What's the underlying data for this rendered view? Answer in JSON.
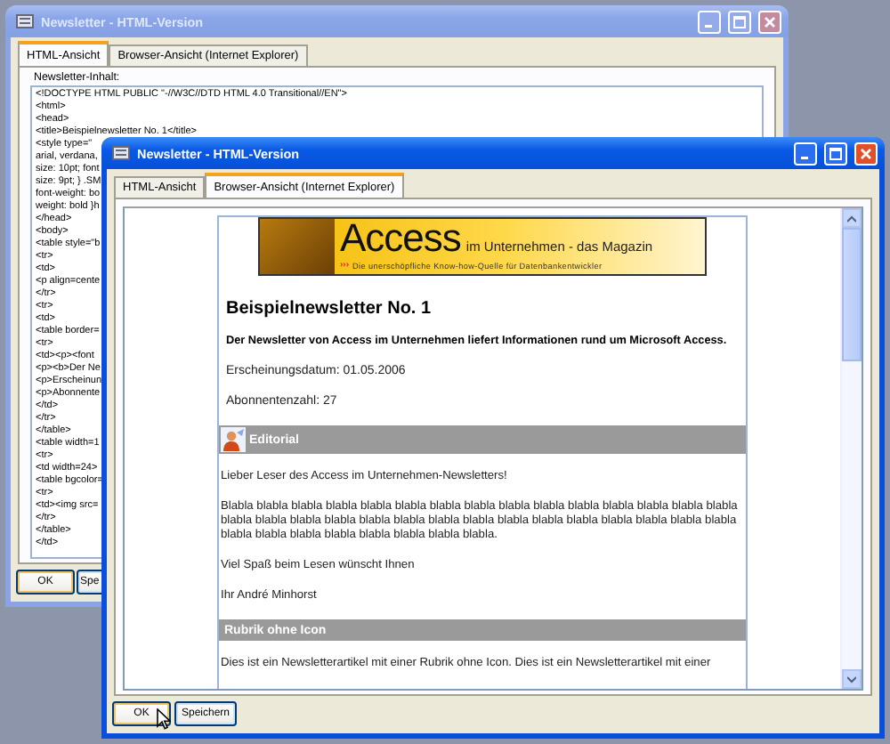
{
  "windows": [
    {
      "kind": "source",
      "title": "Newsletter - HTML-Version",
      "active": false,
      "tabs": [
        {
          "label": "HTML-Ansicht",
          "selected": true
        },
        {
          "label": "Browser-Ansicht (Internet Explorer)",
          "selected": false
        }
      ],
      "field_label": "Newsletter-Inhalt:",
      "code_lines": [
        "<!DOCTYPE HTML PUBLIC \"-//W3C//DTD HTML 4.0 Transitional//EN\">",
        "<html>",
        "<head>",
        "<title>Beispielnewsletter No. 1</title>",
        "<style type=\"",
        "arial, verdana,",
        "size: 10pt; font",
        "size: 9pt; } .SM",
        "font-weight: bo",
        "weight: bold }h",
        "</head>",
        "<body>",
        "<table style=\"b",
        "<tr>",
        "<td>",
        "<p align=cente",
        "</tr>",
        "<tr>",
        "<td>",
        "<table border=",
        "<tr>",
        "<td><p><font",
        "<p><b>Der Ne",
        "<p>Erscheinun",
        "<p>Abonnente",
        "</td>",
        "</tr>",
        "</table>",
        "<table width=1",
        "<tr>",
        "<td width=24>",
        "<table bgcolor=",
        "<tr>",
        "<td><img src=",
        "</tr>",
        "</table>",
        "</td>"
      ],
      "buttons": [
        {
          "label": "OK",
          "focused": true
        },
        {
          "label": "Spe",
          "focused": false
        }
      ]
    },
    {
      "kind": "browser",
      "title": "Newsletter - HTML-Version",
      "active": true,
      "tabs": [
        {
          "label": "HTML-Ansicht",
          "selected": false
        },
        {
          "label": "Browser-Ansicht (Internet Explorer)",
          "selected": true
        }
      ],
      "browser": {
        "banner": {
          "title": "Access",
          "subtitle": "im Unternehmen - das Magazin",
          "marker": "›››",
          "tagline": "Die unerschöpfliche Know-how-Quelle für Datenbankentwickler"
        },
        "heading": "Beispielnewsletter No. 1",
        "intro": "Der Newsletter von Access im Unternehmen liefert Informationen rund um Microsoft Access.",
        "meta": [
          "Erscheinungsdatum: 01.05.2006",
          "Abonnentenzahl: 27"
        ],
        "sections": [
          {
            "title": "Editorial",
            "icon": true,
            "paragraphs": [
              "Lieber Leser des Access im Unternehmen-Newsletters!",
              "Blabla blabla blabla blabla blabla blabla blabla blabla blabla blabla blabla blabla blabla blabla blabla blabla blabla blabla blabla blabla blabla blabla blabla blabla blabla blabla blabla blabla blabla blabla blabla blabla blabla blabla blabla blabla blabla blabla.",
              "Viel Spaß beim Lesen wünscht Ihnen",
              "Ihr André Minhorst"
            ]
          },
          {
            "title": "Rubrik ohne Icon",
            "icon": false,
            "paragraphs": [
              "Dies ist ein Newsletterartikel mit einer Rubrik ohne Icon. Dies ist ein Newsletterartikel mit einer"
            ]
          }
        ]
      },
      "buttons": [
        {
          "label": "OK",
          "focused": true
        },
        {
          "label": "Speichern",
          "focused": false
        }
      ]
    }
  ]
}
